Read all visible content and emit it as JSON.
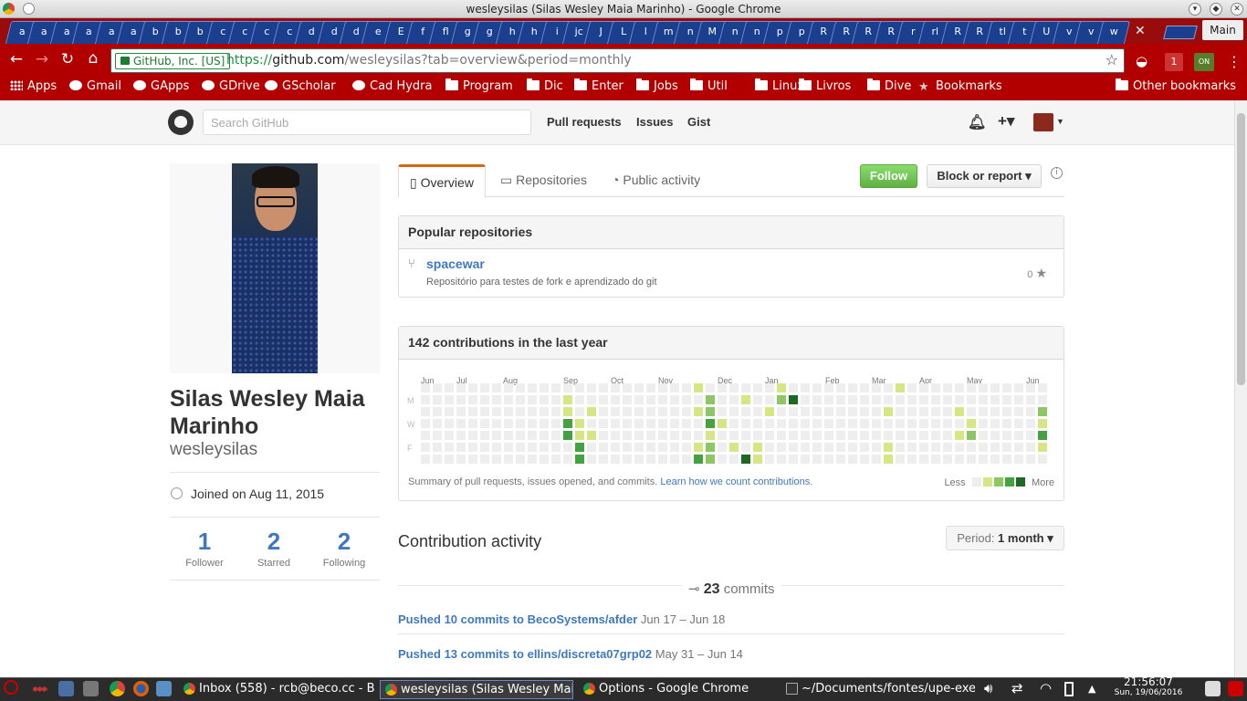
{
  "window": {
    "title": "wesleysilas (Silas Wesley Maia Marinho) - Google Chrome"
  },
  "tabs_strip": {
    "mini_tabs": [
      "a",
      "a",
      "a",
      "a",
      "a",
      "a",
      "b",
      "b",
      "b",
      "c",
      "c",
      "c",
      "c",
      "d",
      "d",
      "d",
      "e",
      "E",
      "f",
      "fl",
      "g",
      "g",
      "h",
      "h",
      "i",
      "jc",
      "J",
      "L",
      "l",
      "m",
      "n",
      "M",
      "n",
      "n",
      "p",
      "p",
      "R",
      "R",
      "R",
      "R",
      "r",
      "rl",
      "R",
      "R",
      "tl",
      "t",
      "U",
      "v",
      "v",
      "w"
    ],
    "close_glyph": "✕",
    "profile_label": "Main"
  },
  "omnibox": {
    "ev_label": "GitHub, Inc. [US]",
    "url_scheme": "https://",
    "url_host": "github.com",
    "url_path": "/wesleysilas?tab=overview&period=monthly"
  },
  "bookmarks": {
    "items": [
      "Apps",
      "Gmail",
      "GApps",
      "GDrive",
      "GScholar",
      "Cad Hydra",
      "Program",
      "Dic",
      "Enter",
      "Jobs",
      "Util",
      "Linux",
      "Livros",
      "Dive",
      "Bookmarks"
    ],
    "other": "Other bookmarks"
  },
  "github_header": {
    "search_placeholder": "Search GitHub",
    "nav": [
      "Pull requests",
      "Issues",
      "Gist"
    ]
  },
  "profile": {
    "full_name": "Silas Wesley Maia Marinho",
    "username": "wesleysilas",
    "joined": "Joined on Aug 11, 2015",
    "stats": [
      {
        "value": "1",
        "label": "Follower"
      },
      {
        "value": "2",
        "label": "Starred"
      },
      {
        "value": "2",
        "label": "Following"
      }
    ]
  },
  "profile_tabs": [
    "Overview",
    "Repositories",
    "Public activity"
  ],
  "actions": {
    "follow": "Follow",
    "block": "Block or report ▾",
    "info": "i"
  },
  "popular": {
    "title": "Popular repositories",
    "repo": {
      "name": "spacewar",
      "description": "Repositório para testes de fork e aprendizado do git",
      "stars": "0"
    }
  },
  "contributions": {
    "title": "142 contributions in the last year",
    "months": [
      "Jun",
      "Jul",
      "Aug",
      "Sep",
      "Oct",
      "Nov",
      "Dec",
      "Jan",
      "Feb",
      "Mar",
      "Apr",
      "May",
      "Jun"
    ],
    "days": [
      "M",
      "W",
      "F"
    ],
    "summary": "Summary of pull requests, issues opened, and commits. ",
    "learn_link": "Learn how we count contributions",
    "learn_suffix": ".",
    "legend_less": "Less",
    "legend_more": "More",
    "colors": [
      "#eeeeee",
      "#d6e685",
      "#8cc665",
      "#44a340",
      "#1e6823"
    ]
  },
  "activity": {
    "title": "Contribution activity",
    "period_label": "Period: ",
    "period_value": "1 month ▾",
    "commits_count": "23",
    "commits_word": "commits",
    "pushes": [
      {
        "text": "Pushed 10 commits to BecoSystems/afder",
        "dates": "Jun 17 – Jun 18"
      },
      {
        "text": "Pushed 13 commits to ellins/discreta07grp02",
        "dates": "May 31 – Jun 14"
      }
    ]
  },
  "taskbar": {
    "tasks": [
      "Inbox (558) - rcb@beco.cc - B",
      "wesleysilas (Silas Wesley Maia",
      "Options - Google Chrome",
      "~/Documents/fontes/upe-exe"
    ],
    "time": "21:56:07",
    "date": "Sun, 19/06/2016"
  }
}
